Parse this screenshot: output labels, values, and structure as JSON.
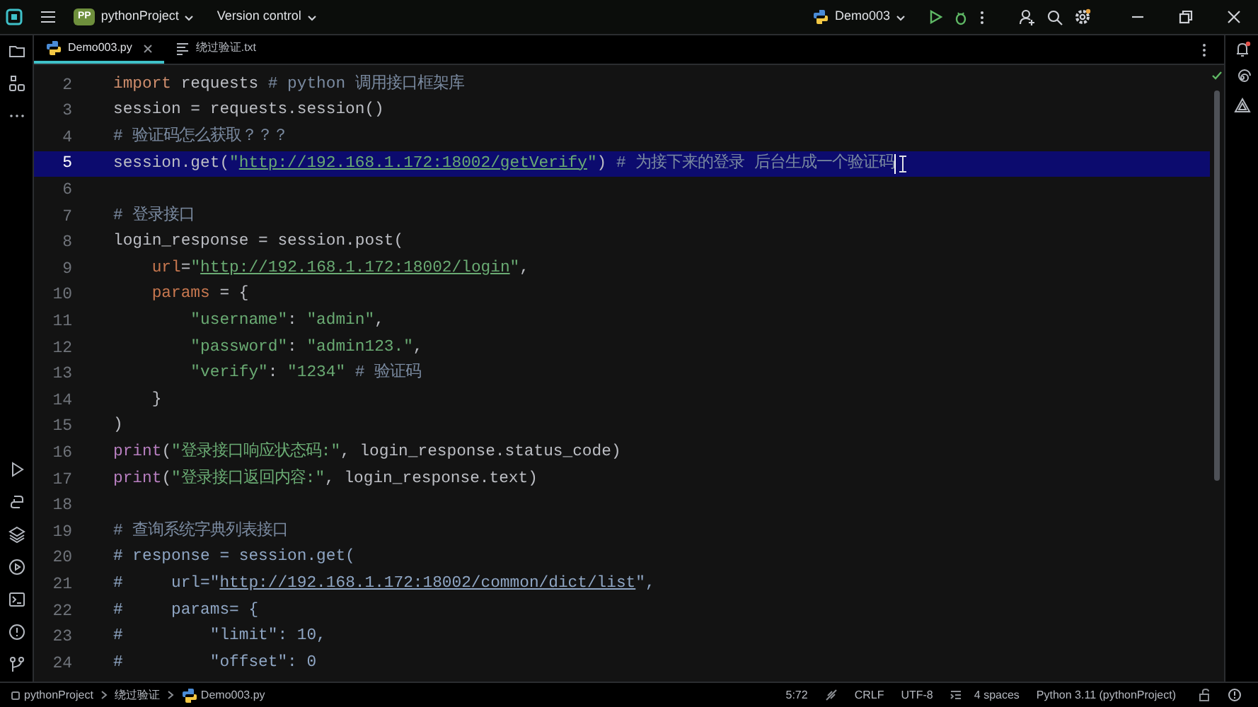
{
  "title_bar": {
    "project_badge": "PP",
    "project": "pythonProject",
    "vcs": "Version control",
    "run_config": "Demo003"
  },
  "tabs": [
    {
      "label": "Demo003.py",
      "selected": true,
      "closable": true,
      "kind": "python"
    },
    {
      "label": "绕过验证.txt",
      "selected": false,
      "closable": false,
      "kind": "text"
    }
  ],
  "editor": {
    "lines": [
      {
        "number": "2",
        "selected": false,
        "segments": [
          {
            "kind": "kw",
            "text": "import"
          },
          {
            "kind": "plain",
            "text": " requests "
          },
          {
            "kind": "cmt",
            "text": "# python 调用接口框架库"
          }
        ]
      },
      {
        "number": "3",
        "selected": false,
        "segments": [
          {
            "kind": "plain",
            "text": "session = requests.session()"
          }
        ]
      },
      {
        "number": "4",
        "selected": false,
        "segments": [
          {
            "kind": "cmt",
            "text": "# 验证码怎么获取？？？"
          }
        ]
      },
      {
        "number": "5",
        "selected": true,
        "segments": [
          {
            "kind": "plain",
            "text": "session.get("
          },
          {
            "kind": "str",
            "text": "\""
          },
          {
            "kind": "link",
            "text": "http://192.168.1.172:18002/getVerify"
          },
          {
            "kind": "str",
            "text": "\""
          },
          {
            "kind": "plain",
            "text": ") "
          },
          {
            "kind": "cmt",
            "text": "# 为接下来的登录 后台生成一个验证码"
          }
        ]
      },
      {
        "number": "6",
        "selected": false
      },
      {
        "number": "7",
        "selected": false,
        "segments": [
          {
            "kind": "cmt",
            "text": "# 登录接口"
          }
        ]
      },
      {
        "number": "8",
        "selected": false,
        "segments": [
          {
            "kind": "plain",
            "text": "login_response = session.post("
          }
        ]
      },
      {
        "number": "9",
        "selected": false,
        "segments": [
          {
            "kind": "param",
            "text": "    url"
          },
          {
            "kind": "plain",
            "text": "="
          },
          {
            "kind": "str",
            "text": "\""
          },
          {
            "kind": "link",
            "text": "http://192.168.1.172:18002/login"
          },
          {
            "kind": "str",
            "text": "\""
          },
          {
            "kind": "plain",
            "text": ","
          }
        ]
      },
      {
        "number": "10",
        "selected": false,
        "segments": [
          {
            "kind": "param",
            "text": "    params"
          },
          {
            "kind": "plain",
            "text": " = {"
          }
        ]
      },
      {
        "number": "11",
        "selected": false,
        "segments": [
          {
            "kind": "str",
            "text": "        \"username\""
          },
          {
            "kind": "plain",
            "text": ": "
          },
          {
            "kind": "str",
            "text": "\"admin\""
          },
          {
            "kind": "plain",
            "text": ","
          }
        ]
      },
      {
        "number": "12",
        "selected": false,
        "segments": [
          {
            "kind": "str",
            "text": "        \"password\""
          },
          {
            "kind": "plain",
            "text": ": "
          },
          {
            "kind": "str",
            "text": "\"admin123.\""
          },
          {
            "kind": "plain",
            "text": ","
          }
        ]
      },
      {
        "number": "13",
        "selected": false,
        "segments": [
          {
            "kind": "str",
            "text": "        \"verify\""
          },
          {
            "kind": "plain",
            "text": ": "
          },
          {
            "kind": "str",
            "text": "\"1234\""
          },
          {
            "kind": "cmt",
            "text": " # 验证码"
          }
        ]
      },
      {
        "number": "14",
        "selected": false,
        "segments": [
          {
            "kind": "plain",
            "text": "    }"
          }
        ]
      },
      {
        "number": "15",
        "selected": false,
        "segments": [
          {
            "kind": "plain",
            "text": ")"
          }
        ]
      },
      {
        "number": "16",
        "selected": false,
        "segments": [
          {
            "kind": "builtin",
            "text": "print"
          },
          {
            "kind": "plain",
            "text": "("
          },
          {
            "kind": "str",
            "text": "\"登录接口响应状态码:\""
          },
          {
            "kind": "plain",
            "text": ", login_response.status_code)"
          }
        ]
      },
      {
        "number": "17",
        "selected": false,
        "segments": [
          {
            "kind": "builtin",
            "text": "print"
          },
          {
            "kind": "plain",
            "text": "("
          },
          {
            "kind": "str",
            "text": "\"登录接口返回内容:\""
          },
          {
            "kind": "plain",
            "text": ", login_response.text)"
          }
        ]
      },
      {
        "number": "18",
        "selected": false
      },
      {
        "number": "19",
        "selected": false,
        "segments": [
          {
            "kind": "cmt",
            "text": "# 查询系统字典列表接口"
          }
        ]
      },
      {
        "number": "20",
        "selected": false,
        "segments": [
          {
            "kind": "dcmt",
            "text": "# response = session.get("
          }
        ]
      },
      {
        "number": "21",
        "selected": false,
        "segments": [
          {
            "kind": "dcmt",
            "text": "#     url=\""
          },
          {
            "kind": "dlink",
            "text": "http://192.168.1.172:18002/common/dict/list"
          },
          {
            "kind": "dcmt",
            "text": "\","
          }
        ]
      },
      {
        "number": "22",
        "selected": false,
        "segments": [
          {
            "kind": "dcmt",
            "text": "#     params= {"
          }
        ]
      },
      {
        "number": "23",
        "selected": false,
        "segments": [
          {
            "kind": "dcmt",
            "text": "#         \"limit\": 10,"
          }
        ]
      },
      {
        "number": "24",
        "selected": false,
        "segments": [
          {
            "kind": "dcmt",
            "text": "#         \"offset\": 0"
          }
        ]
      }
    ]
  },
  "breadcrumbs": [
    "pythonProject",
    "绕过验证",
    "Demo003.py"
  ],
  "status_bar": {
    "position": "5:72",
    "line_separator": "CRLF",
    "encoding": "UTF-8",
    "indent": "4 spaces",
    "interpreter": "Python 3.11 (pythonProject)"
  }
}
